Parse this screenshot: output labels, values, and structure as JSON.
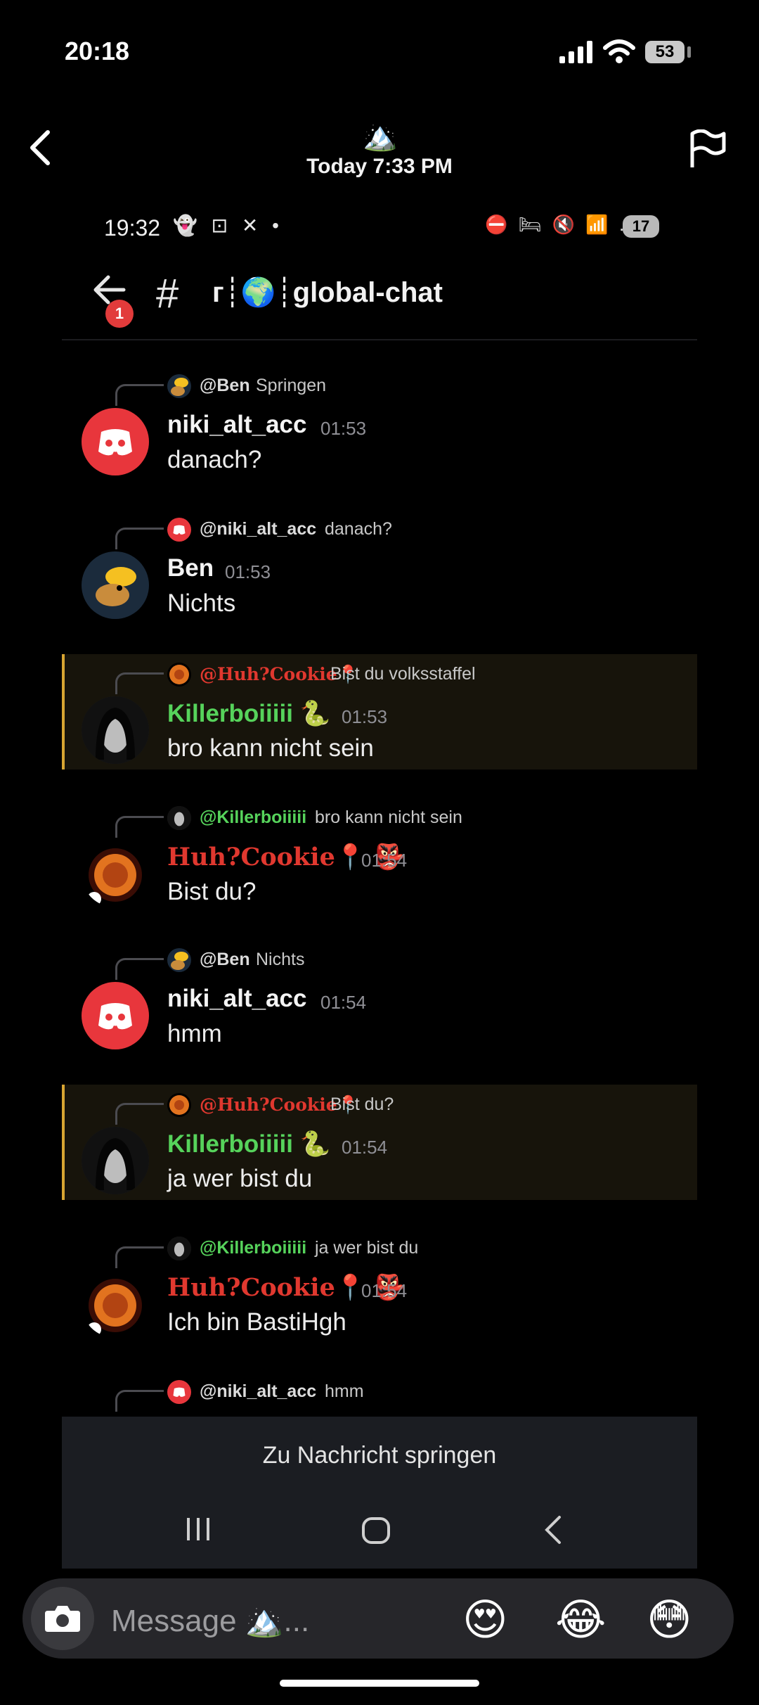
{
  "status_bar": {
    "time": "20:18",
    "battery": "53"
  },
  "story_header": {
    "timestamp": "Today 7:33 PM",
    "story_icon": "🏔️"
  },
  "inner_status": {
    "time": "19:32",
    "icons": "👻 ⊡ ✕ •",
    "right_icons": "⛔ 🛏 🔇 📶 .ıl",
    "battery": "17"
  },
  "channel_header": {
    "badge": "1",
    "hash": "#",
    "name": "ᴦ┊🌍┊global-chat"
  },
  "messages": [
    {
      "reply_name": "@Ben",
      "reply_text": "Springen",
      "name": "niki_alt_acc",
      "time": "01:53",
      "text": "danach?"
    },
    {
      "reply_name": "@niki_alt_acc",
      "reply_text": "danach?",
      "name": "Ben",
      "time": "01:53",
      "text": "Nichts"
    },
    {
      "reply_name": "@Huh?Cookie📍",
      "reply_text": "Bist du volksstaffel",
      "name": "Killerboiiiii 🐍",
      "time": "01:53",
      "text": "bro kann nicht sein"
    },
    {
      "reply_name": "@Killerboiiiii",
      "reply_text": "bro kann nicht sein",
      "name": "Huh?Cookie📍 👺",
      "time": "01:54",
      "text": "Bist du?"
    },
    {
      "reply_name": "@Ben",
      "reply_text": "Nichts",
      "name": "niki_alt_acc",
      "time": "01:54",
      "text": "hmm"
    },
    {
      "reply_name": "@Huh?Cookie📍",
      "reply_text": "Bist du?",
      "name": "Killerboiiiii 🐍",
      "time": "01:54",
      "text": "ja wer bist du"
    },
    {
      "reply_name": "@Killerboiiiii",
      "reply_text": "ja wer bist du",
      "name": "Huh?Cookie📍 👺",
      "time": "01:54",
      "text": "Ich bin BastiHgh"
    },
    {
      "reply_name": "@niki_alt_acc",
      "reply_text": "hmm"
    }
  ],
  "jump_label": "Zu Nachricht springen",
  "composer": {
    "placeholder": "Message 🏔️...",
    "quick_reactions": [
      "😍",
      "😂",
      "😳"
    ]
  },
  "colors": {
    "discord_red": "#e8363c",
    "highlight_bar": "#d8a532",
    "green_name": "#56d35b",
    "red_name": "#e0382f"
  }
}
